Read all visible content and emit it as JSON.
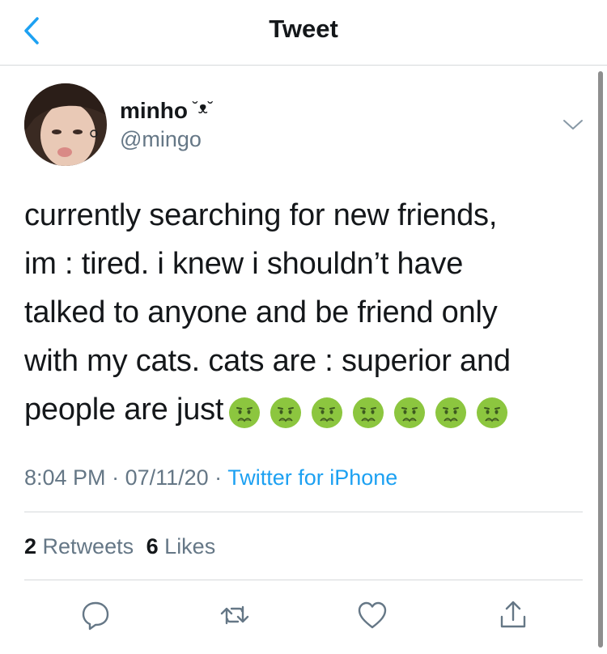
{
  "header": {
    "title": "Tweet"
  },
  "tweet": {
    "display_name": "minho",
    "name_decoration": "˘ᴥ˘",
    "handle": "@mingo",
    "text_lines": [
      "currently searching for new friends,",
      "im : tired. i knew i shouldn’t have",
      "talked to anyone and be friend only",
      "with my cats. cats are : superior and",
      "people are just"
    ],
    "emoji": "nauseated-face",
    "emoji_count": 7,
    "time": "8:04 PM",
    "sep1": " · ",
    "date": "07/11/20",
    "sep2": " · ",
    "source": "Twitter for iPhone"
  },
  "stats": {
    "retweets_count": "2",
    "retweets_label": "Retweets",
    "likes_count": "6",
    "likes_label": "Likes"
  },
  "icons": {
    "back": "chevron-left-icon",
    "caret": "chevron-down-icon",
    "reply": "comment-icon",
    "retweet": "retweet-icon",
    "like": "heart-icon",
    "share": "share-icon"
  },
  "colors": {
    "accent": "#1da1f2",
    "text": "#14171a",
    "secondary": "#657786",
    "divider": "#d6d9db",
    "emoji_face": "#8cc63f"
  }
}
